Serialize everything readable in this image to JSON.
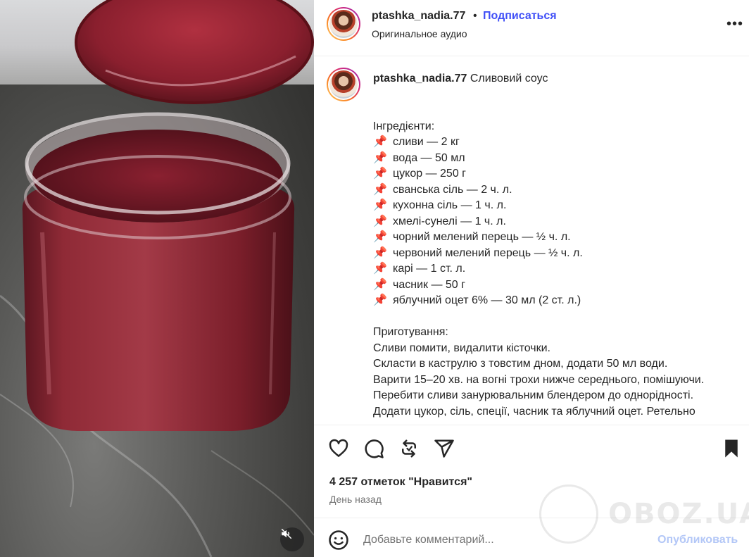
{
  "header": {
    "username": "ptashka_nadia.77",
    "dot": "•",
    "follow_label": "Подписаться",
    "audio": "Оригинальное аудио",
    "more_label": "•••"
  },
  "caption": {
    "username": "ptashka_nadia.77",
    "title": "Сливовий соус",
    "ingredients_heading": "Інгредієнти:",
    "ingredients": [
      "сливи — 2 кг",
      "вода — 50 мл",
      "цукор — 250 г",
      "сванська сіль — 2 ч. л.",
      "кухонна сіль — 1 ч. л.",
      "хмелі-сунелі — 1 ч. л.",
      "чорний мелений перець — ½ ч. л.",
      "червоний мелений перець — ½ ч. л.",
      "карі — 1 ст. л.",
      "часник — 50 г",
      "яблучний оцет 6% — 30 мл (2 ст. л.)"
    ],
    "pin_icon": "📌",
    "prep_heading": "Приготування:",
    "prep_lines": [
      "Сливи помити, видалити кісточки.",
      "Скласти в каструлю з товстим дном, додати 50 мл води.",
      "Варити 15–20 хв. на вогні трохи нижче середнього, помішуючи.",
      "Перебити сливи занурювальним блендером до однорідності.",
      "Додати цукор, сіль, спеції, часник та яблучний оцет. Ретельно"
    ]
  },
  "stats": {
    "likes": "4 257 отметок \"Нравится\"",
    "date": "День назад"
  },
  "comment_box": {
    "placeholder": "Добавьте комментарий...",
    "post_label": "Опубликовать"
  },
  "watermark": {
    "text": "OBOZ.UA"
  },
  "icons": {
    "like": "heart-icon",
    "comment": "comment-icon",
    "repost": "repost-icon",
    "share": "send-icon",
    "save": "bookmark-icon",
    "emoji": "smiley-icon",
    "mute": "speaker-muted-icon"
  },
  "colors": {
    "link": "#4150f7",
    "post_disabled": "#b3c7f7",
    "muted_text": "#737373",
    "text": "#262626"
  }
}
